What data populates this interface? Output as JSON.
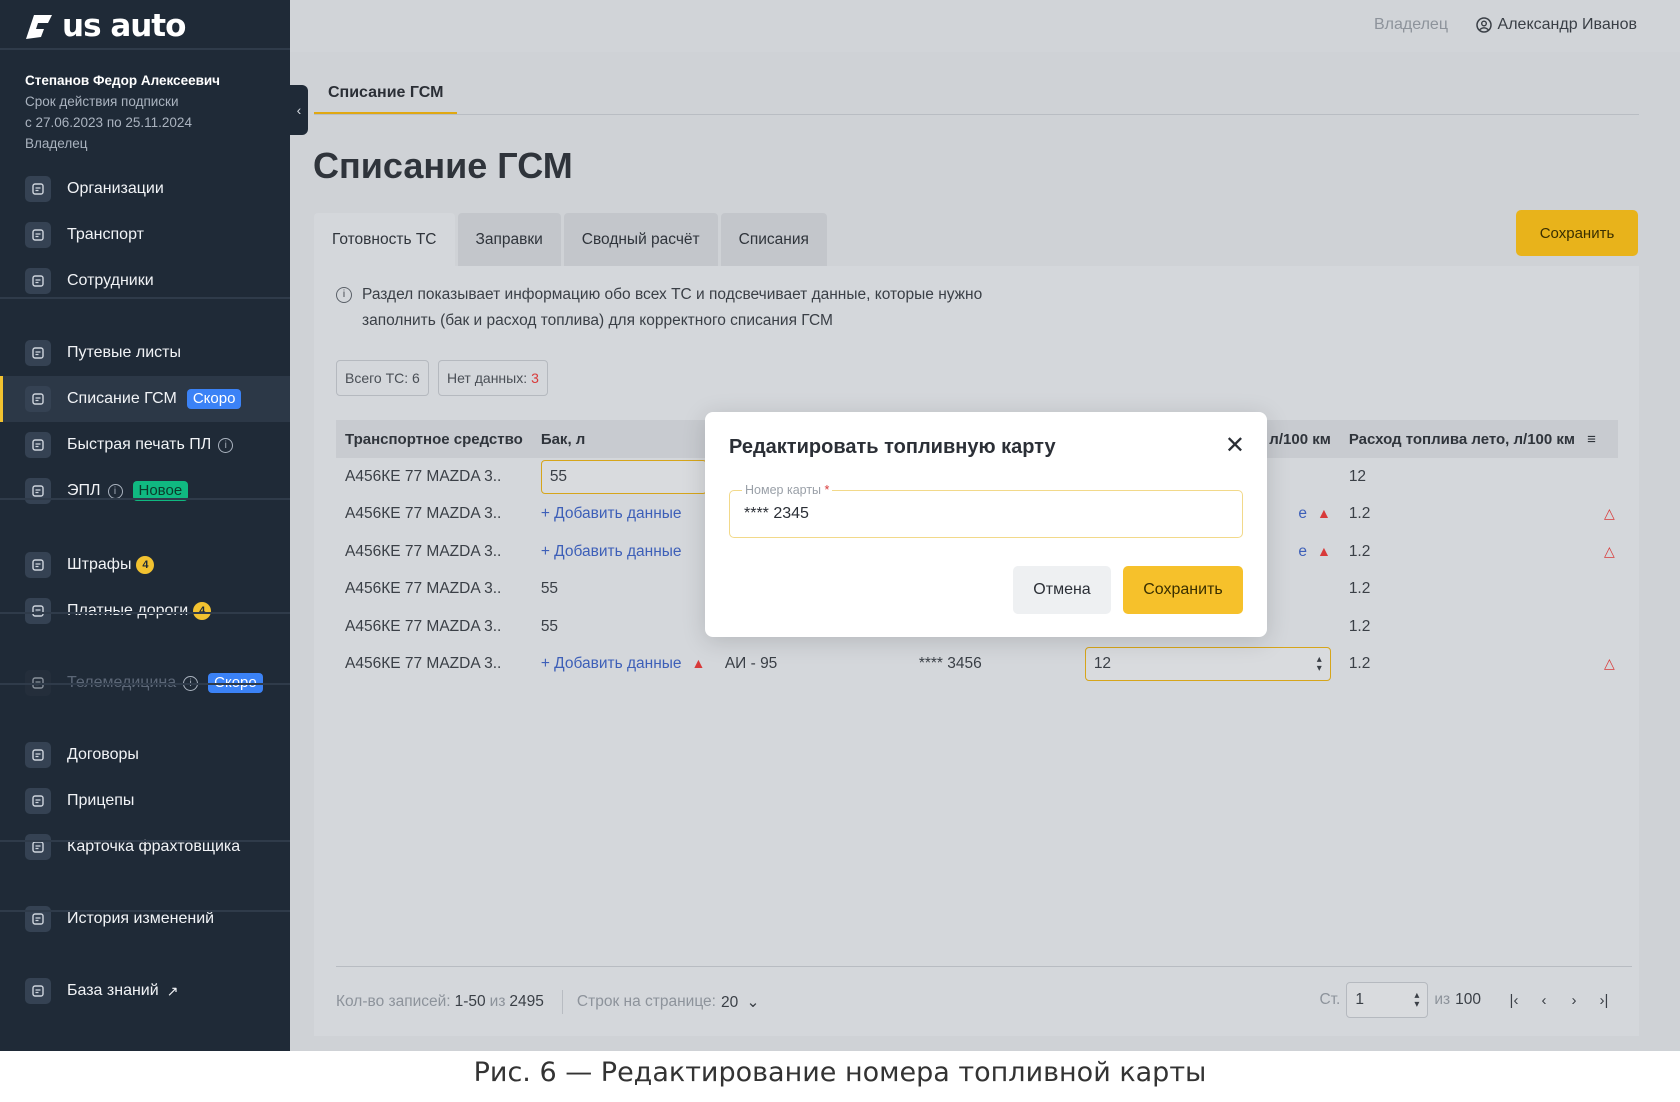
{
  "app": {
    "logo_text": "us auto"
  },
  "user_block": {
    "name": "Степанов Федор Алексеевич",
    "line1": "Срок действия подписки",
    "line2": "с 27.06.2023 по 25.11.2024",
    "role": "Владелец"
  },
  "nav": [
    {
      "label": "Организации",
      "icon": "building-icon"
    },
    {
      "label": "Транспорт",
      "icon": "car-icon"
    },
    {
      "label": "Сотрудники",
      "icon": "users-icon"
    },
    {
      "label": "Путевые листы",
      "icon": "document-icon"
    },
    {
      "label": "Списание ГСМ",
      "icon": "fuel-icon",
      "badge": "Скоро",
      "active": true
    },
    {
      "label": "Быстрая печать ПЛ",
      "icon": "lightning-icon",
      "info": "i"
    },
    {
      "label": "ЭПЛ",
      "icon": "epl-icon",
      "info": "i",
      "badge": "Новое"
    },
    {
      "label": "Штрафы",
      "icon": "fines-icon",
      "count": "4"
    },
    {
      "label": "Платные дороги",
      "icon": "road-icon",
      "count": "4"
    },
    {
      "label": "Телемедицина",
      "icon": "heart-icon",
      "info": "i",
      "badge": "Скоро",
      "disabled": true
    },
    {
      "label": "Договоры",
      "icon": "folder-icon"
    },
    {
      "label": "Прицепы",
      "icon": "trailer-icon"
    },
    {
      "label": "Карточка фрахтовщика",
      "icon": "card-icon"
    },
    {
      "label": "История изменений",
      "icon": "history-icon"
    },
    {
      "label": "База знаний",
      "icon": "bulb-icon",
      "ext": "↗"
    }
  ],
  "header": {
    "role": "Владелец",
    "owner_name": "Александр Иванов"
  },
  "page": {
    "tab_label": "Списание ГСМ",
    "title": "Списание ГСМ",
    "save_label": "Сохранить",
    "tabs": [
      "Готовность ТС",
      "Заправки",
      "Сводный расчёт",
      "Списания"
    ],
    "info_line1": "Раздел показывает информацию обо всех ТС и подсвечивает данные, которые нужно",
    "info_line2": "заполнить (бак и расход топлива) для корректного списания ГСМ",
    "chip_total": "Всего ТС: 6",
    "chip_nodata_label": "Нет данных:",
    "chip_nodata_value": "3"
  },
  "table": {
    "headers": [
      "Транспортное средство",
      "Бак, л",
      "",
      "",
      "ма, л/100 км",
      "Расход топлива лето, л/100 км"
    ],
    "rows": [
      {
        "vehicle": "А456КЕ 77 MAZDA 3..",
        "tank": "55",
        "fuel": "",
        "card": "",
        "winter": "",
        "summer": "12"
      },
      {
        "vehicle": "А456КЕ 77 MAZDA 3..",
        "tank": "+ Добавить данные",
        "fuel": "",
        "card": "",
        "winter": "е",
        "summer": "1.2"
      },
      {
        "vehicle": "А456КЕ 77 MAZDA 3..",
        "tank": "+ Добавить данные",
        "fuel": "",
        "card": "",
        "winter": "е",
        "summer": "1.2"
      },
      {
        "vehicle": "А456КЕ 77 MAZDA 3..",
        "tank": "55",
        "fuel": "",
        "card": "",
        "winter": "",
        "summer": "1.2"
      },
      {
        "vehicle": "А456КЕ 77 MAZDA 3..",
        "tank": "55",
        "fuel": "",
        "card": "",
        "winter": "",
        "summer": "1.2"
      },
      {
        "vehicle": "А456КЕ 77 MAZDA 3..",
        "tank": "+ Добавить данные",
        "fuel": "АИ - 95",
        "card": "**** 3456",
        "winter": "12",
        "summer": "1.2"
      }
    ]
  },
  "footer": {
    "records_label": "Кол-во записей:",
    "records_range": "1-50",
    "records_of": "из",
    "records_total": "2495",
    "rows_label": "Строк на странице:",
    "rows_value": "20",
    "page_label": "Ст.",
    "page_value": "1",
    "page_of": "из",
    "page_total": "100"
  },
  "modal": {
    "title": "Редактировать топливную карту",
    "field_label": "Номер карты",
    "required_mark": "*",
    "field_value": "**** 2345",
    "cancel_label": "Отмена",
    "save_label": "Сохранить"
  },
  "caption": "Рис. 6 — Редактирование номера топливной карты",
  "colors": {
    "accent": "#f6c12b",
    "sidebar": "#1f2a37",
    "soon_badge": "#3b82f6",
    "new_badge": "#10b981",
    "warning": "#d83a3a"
  }
}
